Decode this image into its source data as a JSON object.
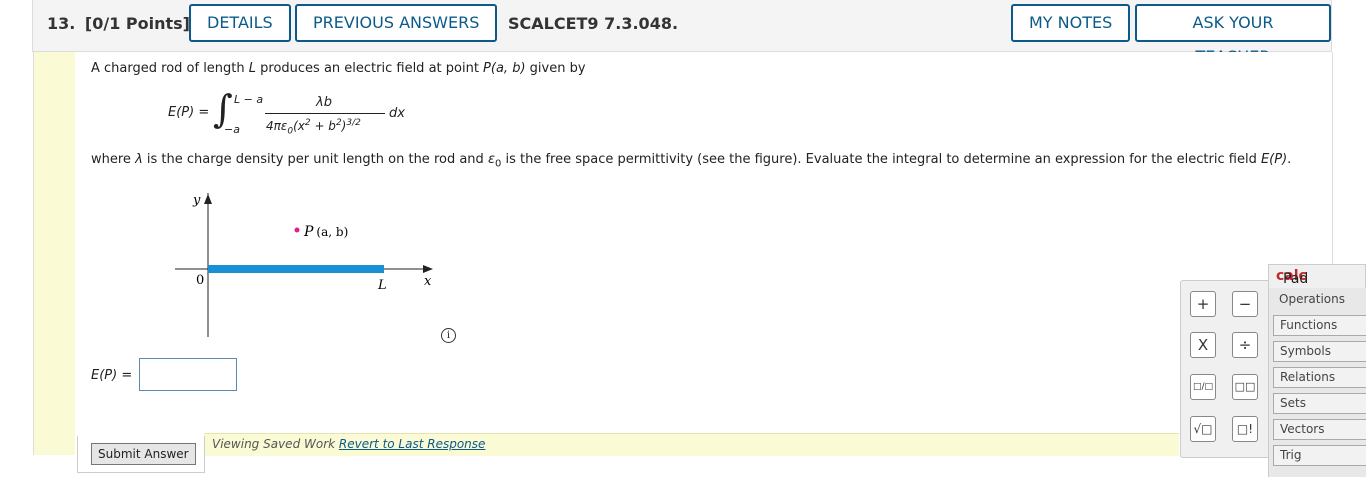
{
  "header": {
    "question_number": "13.",
    "points": "[0/1 Points]",
    "details_label": "DETAILS",
    "previous_answers_label": "PREVIOUS ANSWERS",
    "assignment_code": "SCALCET9 7.3.048.",
    "my_notes_label": "MY NOTES",
    "ask_teacher_label": "ASK YOUR TEACHER"
  },
  "problem": {
    "intro_part1": "A charged rod of length ",
    "intro_L": "L",
    "intro_part2": " produces an electric field at point ",
    "intro_P": "P",
    "intro_args": "(a, b)",
    "intro_part3": " given by",
    "formula": {
      "lhs": "E(P) =",
      "upper_limit": "L − a",
      "lower_limit": "−a",
      "numerator": "λb",
      "denominator_a": "4πε",
      "denominator_sub": "0",
      "denominator_b": "(x",
      "denominator_sup": "2",
      "denominator_c": " + b",
      "denominator_sup2": "2",
      "denominator_d": ")",
      "denominator_sup3": "3/2",
      "dx": "dx"
    },
    "where_part1": "where ",
    "where_lambda": "λ",
    "where_part2": " is the charge density per unit length on the rod and ",
    "where_eps": "ε",
    "where_eps_sub": "0",
    "where_part3": " is the free space permittivity (see the figure). Evaluate the integral to determine an expression for the electric field ",
    "where_EP": "E(P)",
    "where_part4": "."
  },
  "figure": {
    "y_label": "y",
    "x_label": "x",
    "origin_label": "0",
    "rod_label": "L",
    "point_label": "P",
    "point_args": "(a, b)",
    "rod_color": "#1a8fd6",
    "point_color": "#e0218a"
  },
  "answer": {
    "label": "E(P) =",
    "value": ""
  },
  "info_icon": "i",
  "status": {
    "viewing_text": "Viewing Saved Work ",
    "revert_link": "Revert to Last Response"
  },
  "submit_label": "Submit Answer",
  "calcpad": {
    "title_bold": "calc",
    "title_rest": "Pad",
    "buttons": [
      "+",
      "−",
      "X",
      "÷",
      "□/□",
      "□□",
      "√□",
      "□!"
    ],
    "menu": [
      "Operations",
      "Functions",
      "Symbols",
      "Relations",
      "Sets",
      "Vectors",
      "Trig"
    ]
  },
  "colors": {
    "accent": "#0b5a8a",
    "highlight_bar": "#fafad4",
    "calcpad_red": "#c0282d"
  }
}
